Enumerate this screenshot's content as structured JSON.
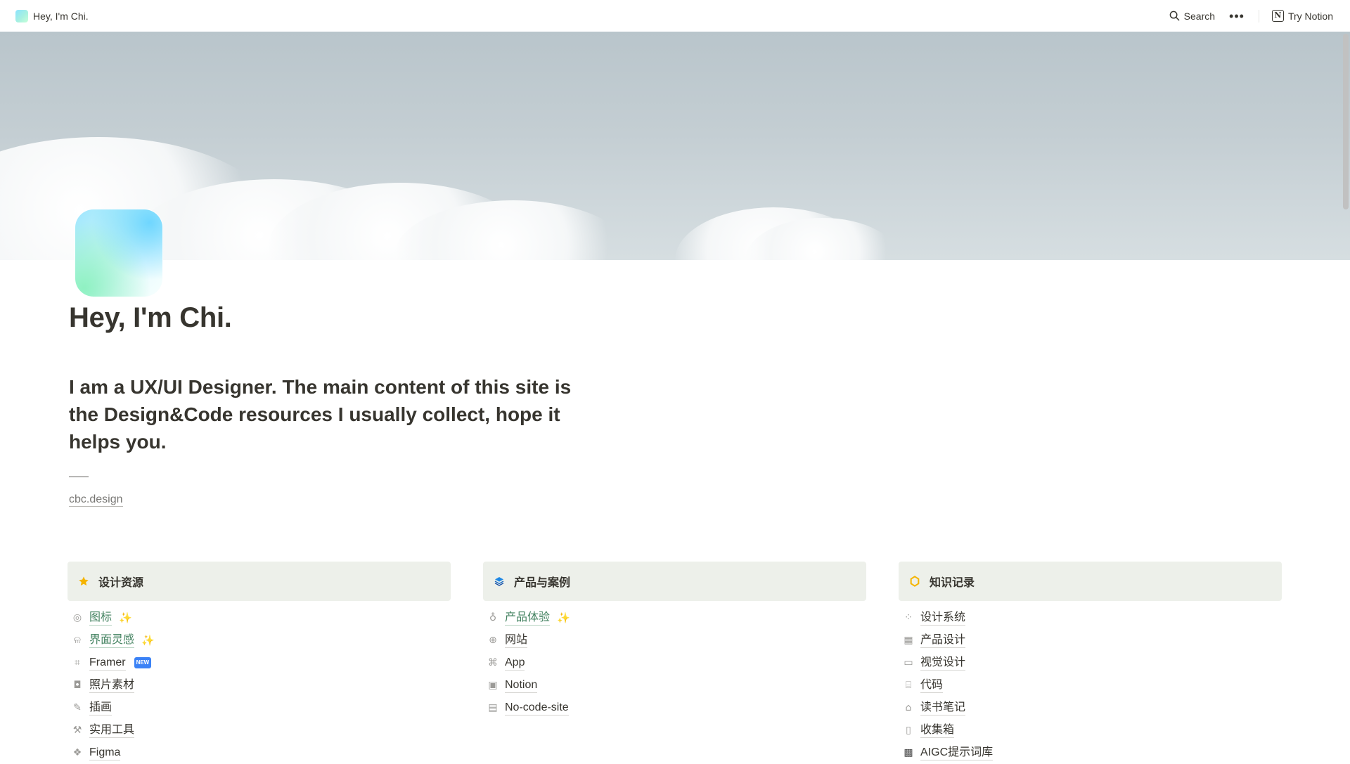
{
  "topbar": {
    "breadcrumb": "Hey, I'm Chi.",
    "search_label": "Search",
    "more_label": "•••",
    "try_notion_label": "Try Notion"
  },
  "page": {
    "title": "Hey, I'm Chi.",
    "intro": "I am a UX/UI Designer. The main content of this site is the Design&Code resources I usually collect, hope it helps you.",
    "link": "cbc.design"
  },
  "columns": [
    {
      "icon": "star-icon",
      "header": "设计资源",
      "items": [
        {
          "icon": "target-icon",
          "label": "图标",
          "green": true,
          "sparkle": "✨"
        },
        {
          "icon": "butterfly-icon",
          "label": "界面灵感",
          "green": true,
          "sparkle": "✨"
        },
        {
          "icon": "framer-icon",
          "label": "Framer",
          "badge": "NEW"
        },
        {
          "icon": "camera-icon",
          "label": "照片素材"
        },
        {
          "icon": "pen-icon",
          "label": "插画"
        },
        {
          "icon": "hammer-icon",
          "label": "实用工具"
        },
        {
          "icon": "figma-icon",
          "label": "Figma"
        }
      ]
    },
    {
      "icon": "stack-icon",
      "header": "产品与案例",
      "items": [
        {
          "icon": "bulb-icon",
          "label": "产品体验",
          "green": true,
          "sparkle": "✨"
        },
        {
          "icon": "globe-icon",
          "label": "网站"
        },
        {
          "icon": "gamepad-icon",
          "label": "App"
        },
        {
          "icon": "notion-icon",
          "label": "Notion"
        },
        {
          "icon": "cup-icon",
          "label": "No-code-site"
        }
      ]
    },
    {
      "icon": "bell-icon",
      "header": "知识记录",
      "items": [
        {
          "icon": "grid-icon",
          "label": "设计系统"
        },
        {
          "icon": "layout-icon",
          "label": "产品设计"
        },
        {
          "icon": "monitor-icon",
          "label": "视觉设计"
        },
        {
          "icon": "code-icon",
          "label": "代码"
        },
        {
          "icon": "book-icon",
          "label": "读书笔记"
        },
        {
          "icon": "doc-icon",
          "label": "收集箱"
        },
        {
          "icon": "archive-icon",
          "label": "AIGC提示词库"
        }
      ]
    }
  ]
}
